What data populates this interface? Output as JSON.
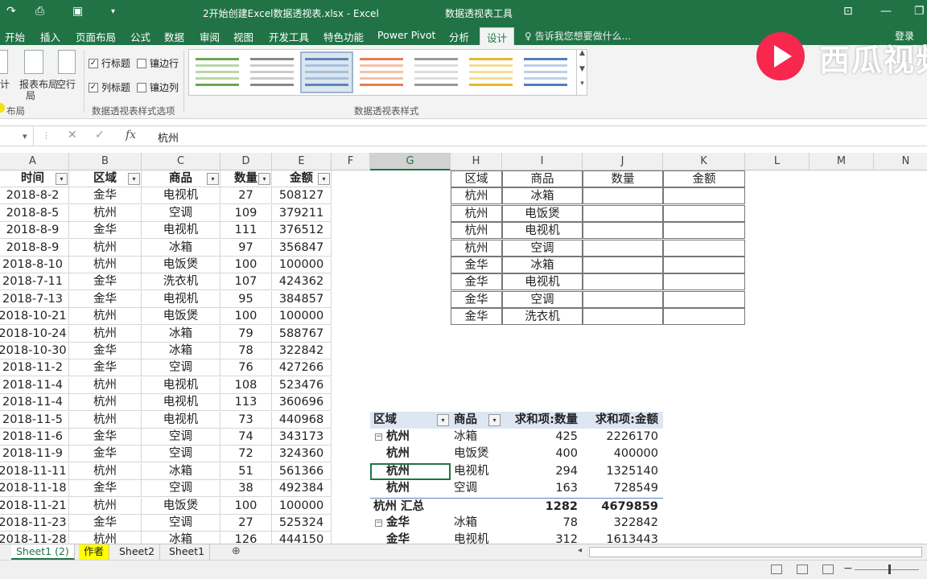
{
  "window": {
    "title": "2开始创建Excel数据透视表.xlsx - Excel",
    "tool_title": "数据透视表工具"
  },
  "menu": {
    "items": [
      "开始",
      "插入",
      "页面布局",
      "公式",
      "数据",
      "审阅",
      "视图",
      "开发工具",
      "特色功能",
      "Power Pivot",
      "分析",
      "设计"
    ],
    "active": "设计",
    "tell_me": "告诉我您想要做什么...",
    "login": "登录"
  },
  "ribbon": {
    "layout_left_label": "计",
    "report_layout_label": "报表布局",
    "report_layout_sub": "局",
    "blank_rows_label": "空行",
    "layout_group": "布局",
    "options": {
      "row_headers": "行标题",
      "col_headers": "列标题",
      "banded_rows": "镶边行",
      "banded_cols": "镶边列",
      "row_headers_checked": true,
      "col_headers_checked": true,
      "banded_rows_checked": false,
      "banded_cols_checked": false
    },
    "options_group": "数据透视表样式选项",
    "styles_group": "数据透视表样式"
  },
  "formula_bar": {
    "value": "杭州"
  },
  "columns": [
    "A",
    "B",
    "C",
    "D",
    "E",
    "F",
    "G",
    "H",
    "I",
    "J",
    "K",
    "L",
    "M",
    "N"
  ],
  "selected_column": "G",
  "source_table": {
    "headers": [
      "时间",
      "区域",
      "商品",
      "数量",
      "金额"
    ],
    "rows": [
      [
        "2018-8-2",
        "金华",
        "电视机",
        "27",
        "508127"
      ],
      [
        "2018-8-5",
        "杭州",
        "空调",
        "109",
        "379211"
      ],
      [
        "2018-8-9",
        "金华",
        "电视机",
        "111",
        "376512"
      ],
      [
        "2018-8-9",
        "杭州",
        "冰箱",
        "97",
        "356847"
      ],
      [
        "2018-8-10",
        "杭州",
        "电饭煲",
        "100",
        "100000"
      ],
      [
        "2018-7-11",
        "金华",
        "洗衣机",
        "107",
        "424362"
      ],
      [
        "2018-7-13",
        "金华",
        "电视机",
        "95",
        "384857"
      ],
      [
        "2018-10-21",
        "杭州",
        "电饭煲",
        "100",
        "100000"
      ],
      [
        "2018-10-24",
        "杭州",
        "冰箱",
        "79",
        "588767"
      ],
      [
        "2018-10-30",
        "金华",
        "冰箱",
        "78",
        "322842"
      ],
      [
        "2018-11-2",
        "金华",
        "空调",
        "76",
        "427266"
      ],
      [
        "2018-11-4",
        "杭州",
        "电视机",
        "108",
        "523476"
      ],
      [
        "2018-11-4",
        "杭州",
        "电视机",
        "113",
        "360696"
      ],
      [
        "2018-11-5",
        "杭州",
        "电视机",
        "73",
        "440968"
      ],
      [
        "2018-11-6",
        "金华",
        "空调",
        "74",
        "343173"
      ],
      [
        "2018-11-9",
        "金华",
        "空调",
        "72",
        "324360"
      ],
      [
        "2018-11-11",
        "杭州",
        "冰箱",
        "51",
        "561366"
      ],
      [
        "2018-11-18",
        "金华",
        "空调",
        "38",
        "492384"
      ],
      [
        "2018-11-21",
        "杭州",
        "电饭煲",
        "100",
        "100000"
      ],
      [
        "2018-11-23",
        "金华",
        "空调",
        "27",
        "525324"
      ],
      [
        "2018-11-28",
        "杭州",
        "冰箱",
        "126",
        "444150"
      ]
    ]
  },
  "summary_table": {
    "headers": [
      "区域",
      "商品",
      "数量",
      "金额"
    ],
    "rows": [
      [
        "杭州",
        "冰箱"
      ],
      [
        "杭州",
        "电饭煲"
      ],
      [
        "杭州",
        "电视机"
      ],
      [
        "杭州",
        "空调"
      ],
      [
        "金华",
        "冰箱"
      ],
      [
        "金华",
        "电视机"
      ],
      [
        "金华",
        "空调"
      ],
      [
        "金华",
        "洗衣机"
      ]
    ]
  },
  "pivot": {
    "headers": [
      "区域",
      "商品",
      "求和项:数量",
      "求和项:金额"
    ],
    "rows": [
      {
        "region": "杭州",
        "item": "冰箱",
        "qty": "425",
        "amt": "2226170",
        "first": true
      },
      {
        "region": "杭州",
        "item": "电饭煲",
        "qty": "400",
        "amt": "400000"
      },
      {
        "region": "杭州",
        "item": "电视机",
        "qty": "294",
        "amt": "1325140"
      },
      {
        "region": "杭州",
        "item": "空调",
        "qty": "163",
        "amt": "728549"
      },
      {
        "subtotal": "杭州 汇总",
        "qty": "1282",
        "amt": "4679859"
      },
      {
        "region": "金华",
        "item": "冰箱",
        "qty": "78",
        "amt": "322842",
        "first": true
      },
      {
        "region": "金华",
        "item": "电视机",
        "qty": "312",
        "amt": "1613443"
      }
    ]
  },
  "sheets": {
    "tabs": [
      "Sheet1 (2)",
      "作者",
      "Sheet2",
      "Sheet1"
    ],
    "active": "Sheet1 (2)",
    "highlighted": "作者"
  },
  "watermark": {
    "text": "西瓜视频"
  },
  "colors": {
    "excel_green": "#217346",
    "pivot_header": "#dde7f3",
    "logo_red": "#f7274e"
  }
}
